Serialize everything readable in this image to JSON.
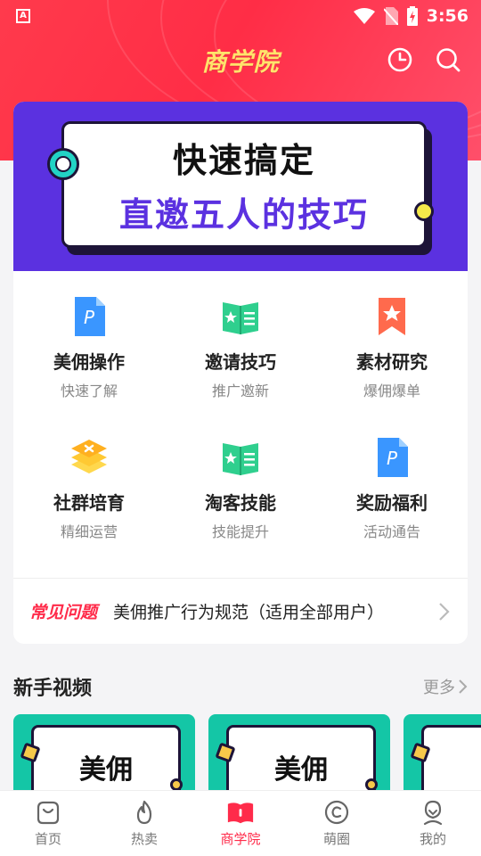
{
  "status_bar": {
    "time": "3:56"
  },
  "header": {
    "title": "商学院"
  },
  "banner": {
    "line1": "快速搞定",
    "line2": "直邀五人的技巧"
  },
  "grid": [
    {
      "title": "美佣操作",
      "subtitle": "快速了解",
      "icon": "document-p-icon"
    },
    {
      "title": "邀请技巧",
      "subtitle": "推广邀新",
      "icon": "open-book-icon"
    },
    {
      "title": "素材研究",
      "subtitle": "爆佣爆单",
      "icon": "bookmark-star-icon"
    },
    {
      "title": "社群培育",
      "subtitle": "精细运营",
      "icon": "layers-icon"
    },
    {
      "title": "淘客技能",
      "subtitle": "技能提升",
      "icon": "open-book-icon"
    },
    {
      "title": "奖励福利",
      "subtitle": "活动通告",
      "icon": "document-p-icon"
    }
  ],
  "faq": {
    "tag": "常见问题",
    "text": "美佣推广行为规范（适用全部用户）"
  },
  "section": {
    "title": "新手视频",
    "more": "更多"
  },
  "videos": [
    {
      "title": "美佣"
    },
    {
      "title": "美佣"
    },
    {
      "title": ""
    }
  ],
  "tabs": [
    {
      "label": "首页",
      "icon": "home-bag-icon"
    },
    {
      "label": "热卖",
      "icon": "flame-icon"
    },
    {
      "label": "商学院",
      "icon": "book-icon",
      "active": true
    },
    {
      "label": "萌圈",
      "icon": "chat-circle-icon"
    },
    {
      "label": "我的",
      "icon": "profile-icon"
    }
  ],
  "colors": {
    "brand_red": "#ff2b4a",
    "banner_purple": "#5b31e0",
    "title_yellow": "#ffe36b",
    "video_teal": "#14c6a6"
  }
}
